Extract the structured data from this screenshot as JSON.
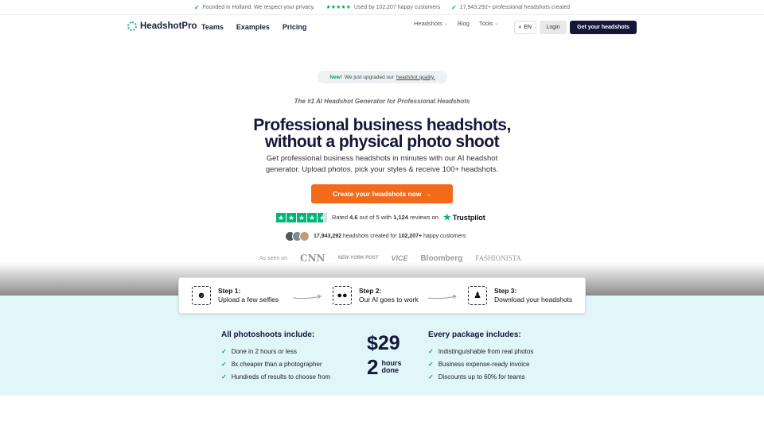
{
  "topbar": {
    "items": [
      {
        "text": "Founded in Holland. We respect your privacy."
      },
      {
        "stars": "★★★★★",
        "text": "Used by 102,207 happy customers"
      },
      {
        "text": "17,943,292+ professional headshots created"
      }
    ]
  },
  "nav": {
    "logo": "HeadshotPro",
    "links": [
      "Teams",
      "Examples",
      "Pricing"
    ],
    "right": {
      "headshots": "Headshots",
      "blog": "Blog",
      "tools": "Tools"
    },
    "lang": "EN",
    "login": "Login",
    "get": "Get your headshots"
  },
  "hero": {
    "pill_new": "New!",
    "pill_text": "We just upgraded our",
    "pill_link": "headshot quality.",
    "eyebrow": "The #1 AI Headshot Generator for Professional Headshots",
    "title_1": "Professional business headshots,",
    "title_2": "without a physical photo shoot",
    "sub_1": "Get professional business headshots in minutes with our AI headshot",
    "sub_2": "generator. Upload photos, pick your styles & receive 100+ headshots.",
    "cta": "Create your headshots now"
  },
  "trust": {
    "rated": "Rated",
    "score": "4.6",
    "out_of": "out of 5 with",
    "reviews_count": "1,124",
    "reviews_on": "reviews on",
    "brand": "Trustpilot"
  },
  "happy": {
    "count": "17,943,292",
    "mid": "headshots created for",
    "customers": "102,207+",
    "tail": "happy customers"
  },
  "seen": {
    "label": "As seen on",
    "logos": [
      "CNN",
      "NEW YORK POST",
      "VICE",
      "Bloomberg",
      "FASHIONISTA"
    ]
  },
  "steps": [
    {
      "title": "Step 1:",
      "text": "Upload a few selfies"
    },
    {
      "title": "Step 2:",
      "text": "Our AI goes to work"
    },
    {
      "title": "Step 3:",
      "text": "Download your headshots"
    }
  ],
  "left_list": {
    "heading": "All photoshoots include:",
    "items": [
      "Done in 2 hours or less",
      "8x cheaper than a photographer",
      "Hundreds of results to choose from"
    ]
  },
  "right_list": {
    "heading": "Every package includes:",
    "items": [
      "Indistinguishable from real photos",
      "Business expense-ready invoice",
      "Discounts up to 60% for teams"
    ]
  },
  "price": {
    "amount": "$29",
    "hours_num": "2",
    "hours_word": "hours",
    "done_word": "done"
  },
  "colors": {
    "brand_dark": "#14173a",
    "cta_orange": "#f26a1a",
    "check_green": "#18a05f",
    "trustpilot_green": "#00b67a",
    "teal_bg": "#e0f6f8"
  }
}
